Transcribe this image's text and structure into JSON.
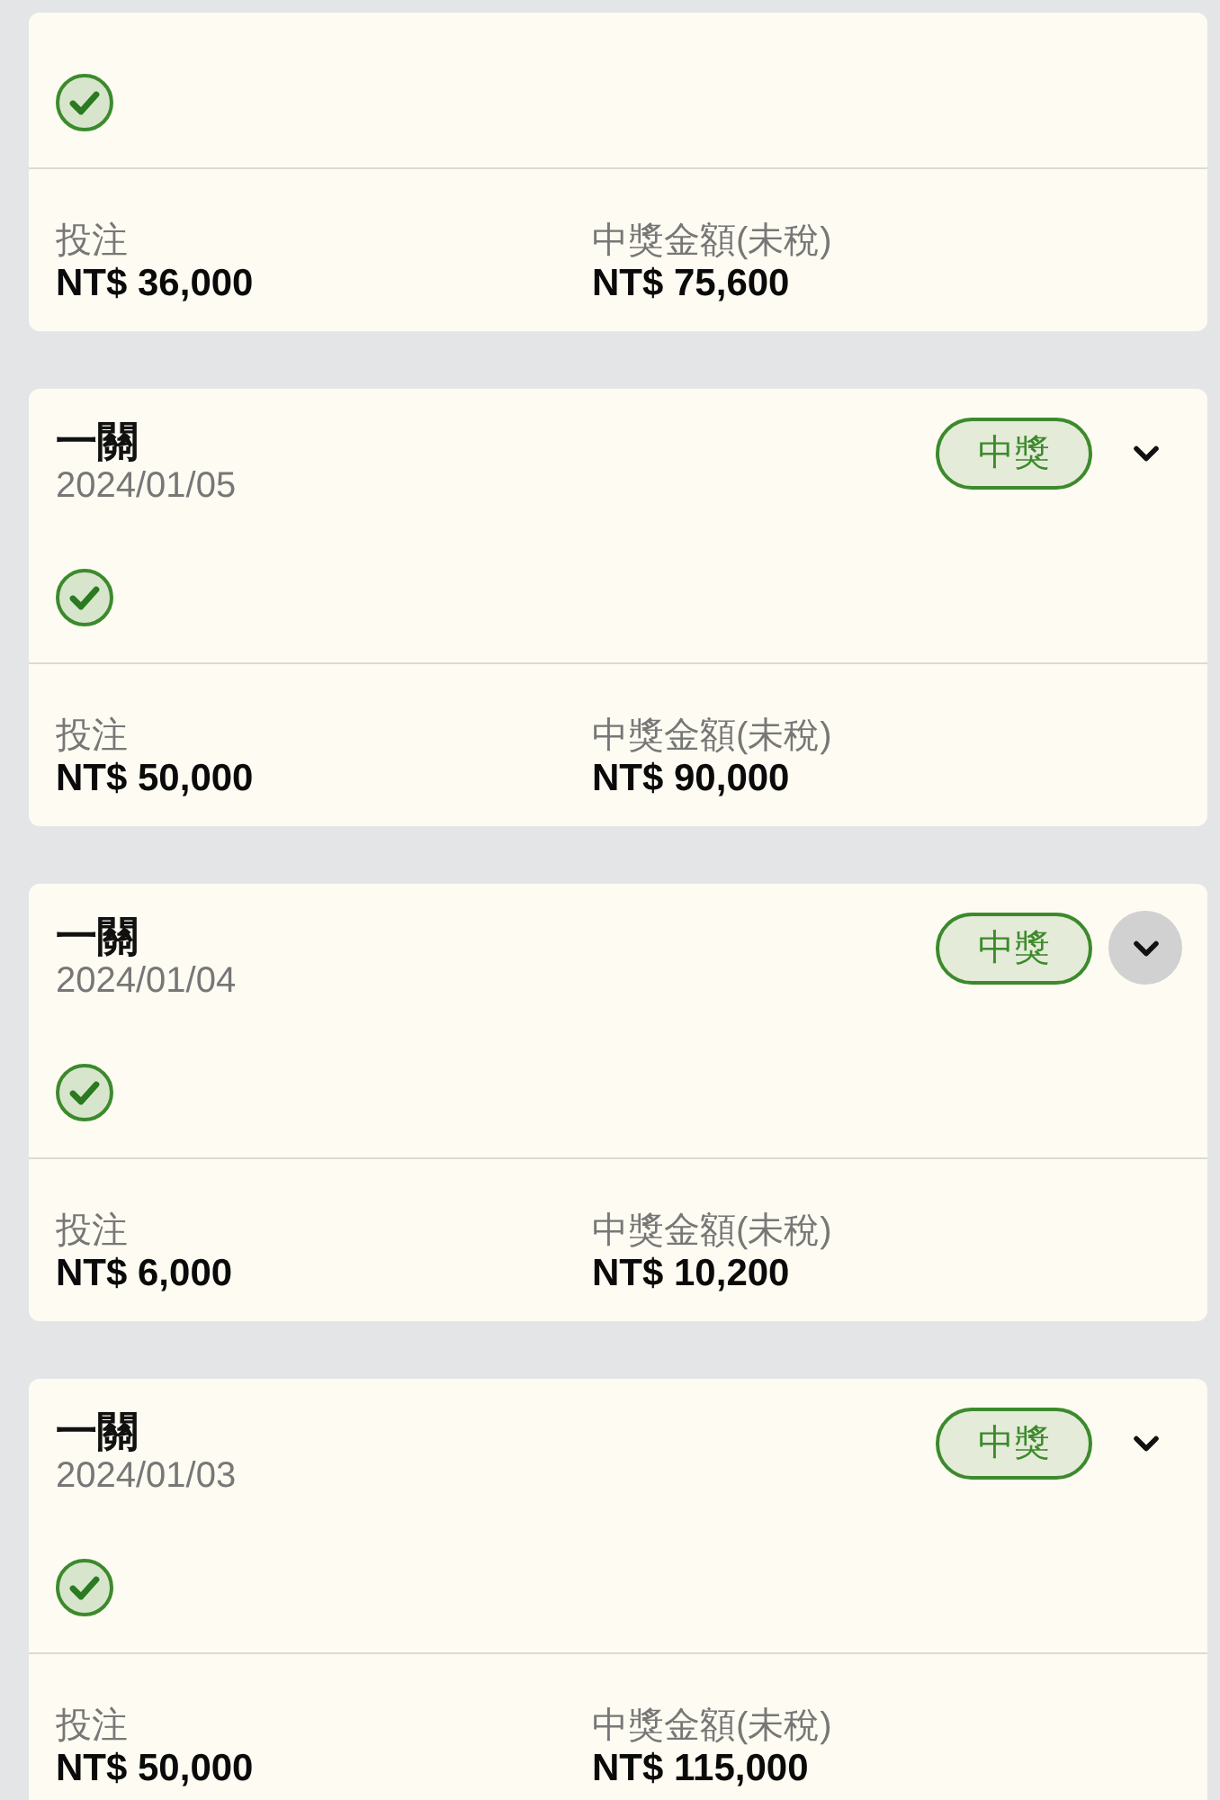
{
  "cards": [
    {
      "legs": [
        {
          "won": true
        }
      ],
      "fields": [
        {
          "label": "投注",
          "value": "NT$ 36,000"
        },
        {
          "label": "中獎金額(未稅)",
          "value": "NT$ 75,600"
        }
      ]
    },
    {
      "title": "一關",
      "date": "2024/01/05",
      "badge": "中獎",
      "toggle_pressed": false,
      "legs": [
        {
          "won": true
        }
      ],
      "fields": [
        {
          "label": "投注",
          "value": "NT$ 50,000"
        },
        {
          "label": "中獎金額(未稅)",
          "value": "NT$ 90,000"
        }
      ]
    },
    {
      "title": "一關",
      "date": "2024/01/04",
      "badge": "中獎",
      "toggle_pressed": true,
      "legs": [
        {
          "won": true
        }
      ],
      "fields": [
        {
          "label": "投注",
          "value": "NT$ 6,000"
        },
        {
          "label": "中獎金額(未稅)",
          "value": "NT$ 10,200"
        }
      ]
    },
    {
      "title": "一關",
      "date": "2024/01/03",
      "badge": "中獎",
      "toggle_pressed": false,
      "legs": [
        {
          "won": true
        }
      ],
      "fields": [
        {
          "label": "投注",
          "value": "NT$ 50,000"
        },
        {
          "label": "中獎金額(未稅)",
          "value": "NT$ 115,000"
        }
      ]
    }
  ]
}
